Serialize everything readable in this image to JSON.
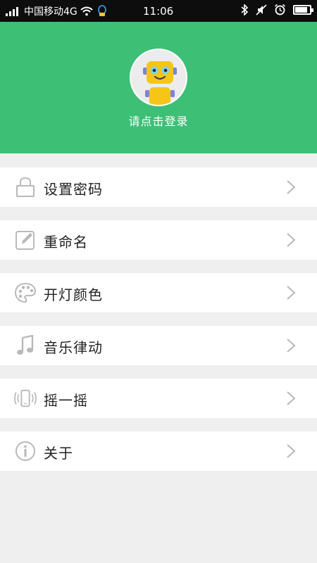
{
  "status_bar": {
    "carrier": "中国移动4G",
    "time": "11:06",
    "battery_level": 0.85
  },
  "header": {
    "login_prompt": "请点击登录",
    "background_color": "#3dbf76",
    "avatar_icon": "robot-avatar-icon"
  },
  "menu": {
    "items": [
      {
        "label": "设置密码",
        "icon": "lock-icon"
      },
      {
        "label": "重命名",
        "icon": "edit-icon"
      },
      {
        "label": "开灯颜色",
        "icon": "palette-icon"
      },
      {
        "label": "音乐律动",
        "icon": "music-note-icon"
      },
      {
        "label": "摇一摇",
        "icon": "shake-phone-icon"
      },
      {
        "label": "关于",
        "icon": "info-icon"
      }
    ]
  },
  "colors": {
    "accent": "#3dbf76",
    "page_bg": "#efefef",
    "icon_gray": "#b9b9b9"
  }
}
